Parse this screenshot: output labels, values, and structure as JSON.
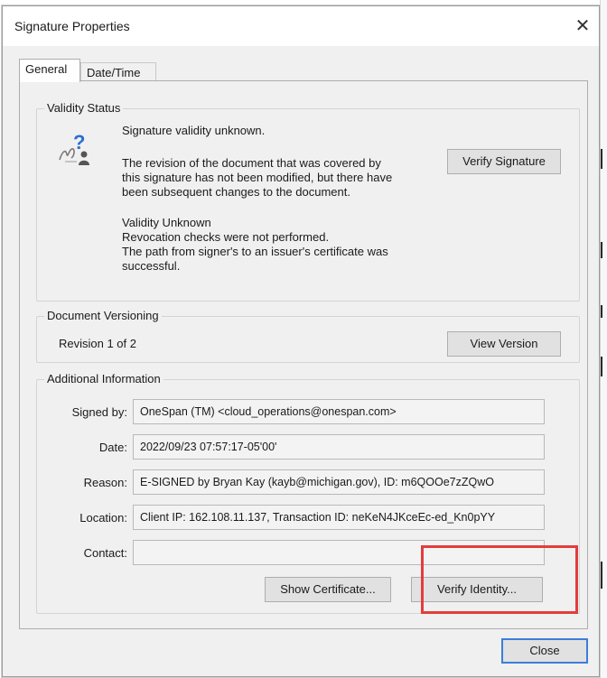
{
  "window": {
    "title": "Signature Properties",
    "close_glyph": "✕"
  },
  "tabs": [
    {
      "label": "General",
      "selected": true
    },
    {
      "label": "Date/Time",
      "selected": false
    }
  ],
  "validity_status": {
    "heading": "Validity Status",
    "icon": "signature-unknown-icon",
    "summary": "Signature validity unknown.",
    "revision_note_lines": [
      "The revision of the document that was covered by",
      "this signature has not been modified, but there have",
      "been subsequent changes to the document."
    ],
    "detail_lines": [
      "Validity Unknown",
      "Revocation checks were not performed.",
      "The path from signer's to an issuer's certificate was",
      "successful."
    ],
    "verify_button": "Verify Signature"
  },
  "document_versioning": {
    "heading": "Document Versioning",
    "revision_text": "Revision 1 of 2",
    "view_button": "View Version"
  },
  "additional_information": {
    "heading": "Additional Information",
    "fields": [
      {
        "label": "Signed by:",
        "value": "OneSpan (TM) <cloud_operations@onespan.com>"
      },
      {
        "label": "Date:",
        "value": "2022/09/23 07:57:17-05'00'"
      },
      {
        "label": "Reason:",
        "value": "E-SIGNED by Bryan Kay (kayb@michigan.gov), ID: m6QOOe7zZQwO"
      },
      {
        "label": "Location:",
        "value": "Client IP: 162.108.11.137, Transaction ID: neKeN4JKceEc-ed_Kn0pYY"
      },
      {
        "label": "Contact:",
        "value": ""
      }
    ],
    "show_certificate_button": "Show Certificate...",
    "verify_identity_button": "Verify Identity..."
  },
  "footer": {
    "close_button": "Close"
  },
  "colors": {
    "dialog_bg": "#f0f0f0",
    "highlight": "#e23d3d",
    "default_button_border": "#3b7ddb"
  }
}
